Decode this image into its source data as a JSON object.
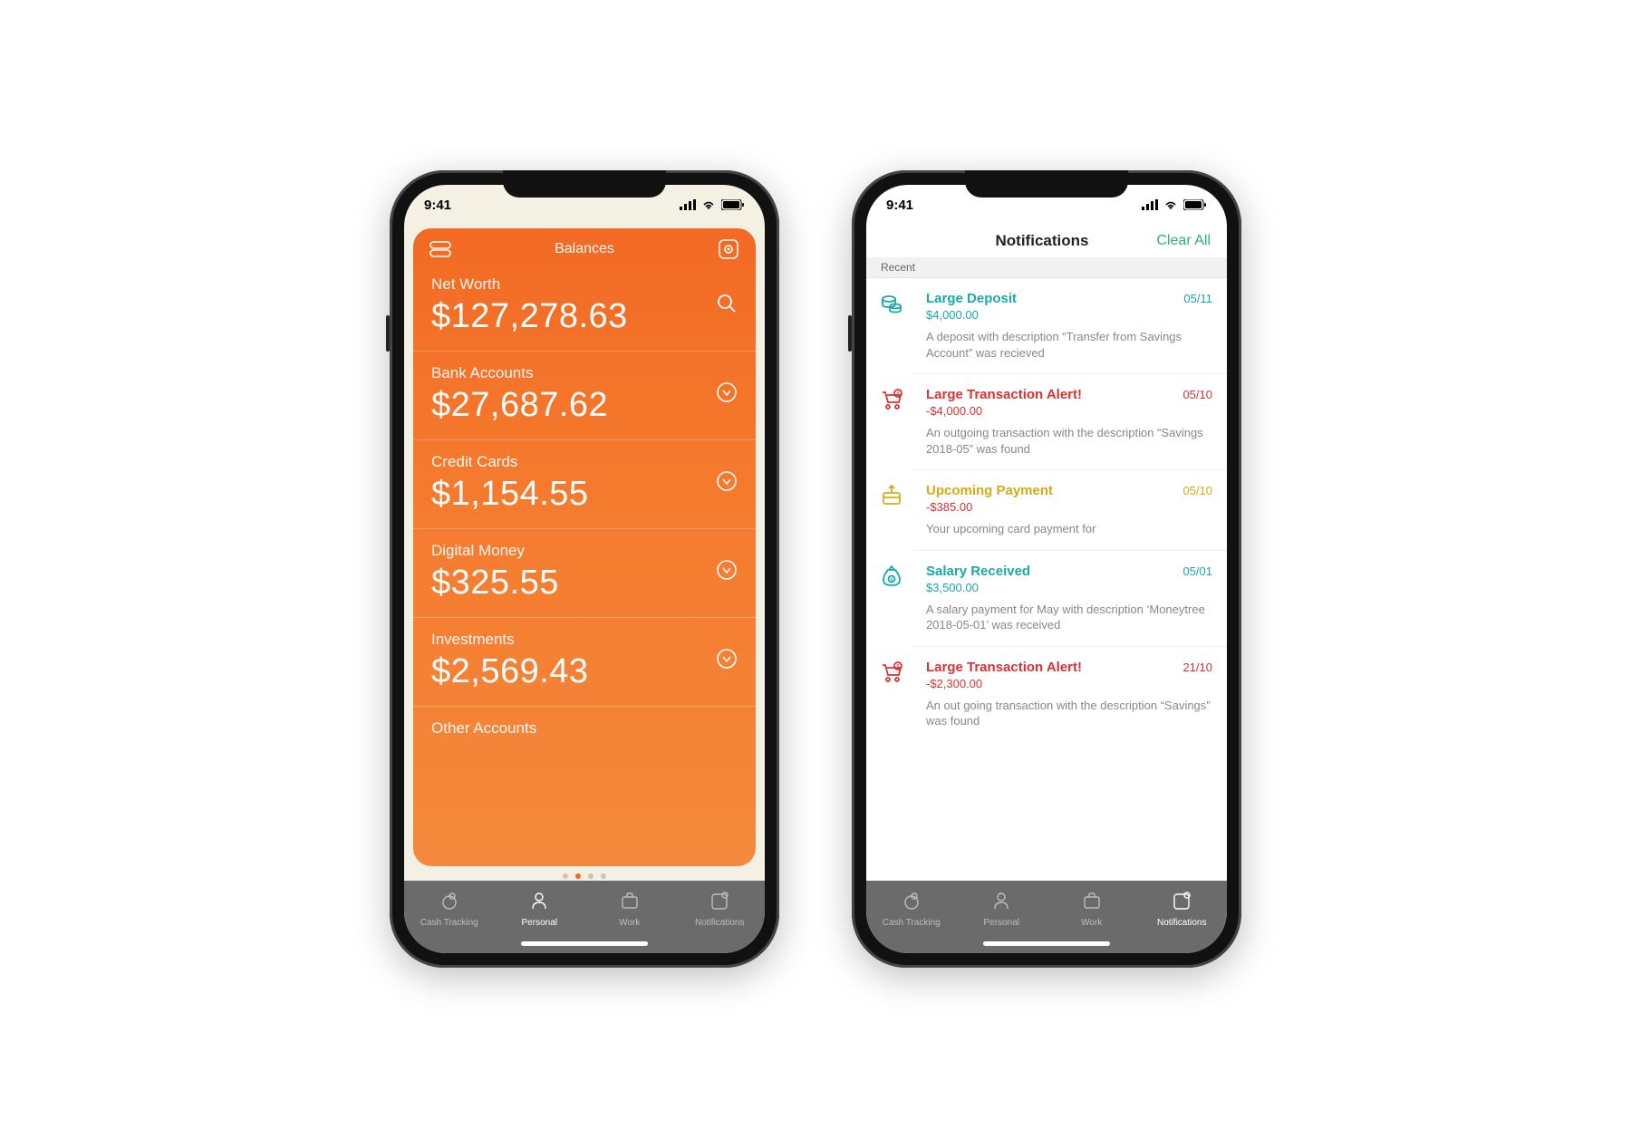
{
  "status": {
    "time": "9:41"
  },
  "balances": {
    "header_title": "Balances",
    "rows": [
      {
        "label": "Net Worth",
        "amount": "$127,278.63",
        "action_icon": "search"
      },
      {
        "label": "Bank Accounts",
        "amount": "$27,687.62",
        "action_icon": "chevron"
      },
      {
        "label": "Credit Cards",
        "amount": "$1,154.55",
        "action_icon": "chevron"
      },
      {
        "label": "Digital Money",
        "amount": "$325.55",
        "action_icon": "chevron"
      },
      {
        "label": "Investments",
        "amount": "$2,569.43",
        "action_icon": "chevron"
      },
      {
        "label": "Other Accounts",
        "amount": "",
        "action_icon": ""
      }
    ]
  },
  "tabs": {
    "items": [
      {
        "label": "Cash Tracking"
      },
      {
        "label": "Personal"
      },
      {
        "label": "Work"
      },
      {
        "label": "Notifications"
      }
    ]
  },
  "notifications": {
    "header_title": "Notifications",
    "clear_label": "Clear All",
    "section_label": "Recent",
    "items": [
      {
        "title": "Large Deposit",
        "amount": "$4,000.00",
        "date": "05/11",
        "desc": "A deposit with description “Transfer from Savings Account” was recieved",
        "color": "teal",
        "icon": "coins"
      },
      {
        "title": "Large Transaction Alert!",
        "amount": "-$4,000.00",
        "date": "05/10",
        "desc": "An outgoing transaction with the description “Savings 2018-05” was found",
        "color": "red",
        "icon": "cart"
      },
      {
        "title": "Upcoming Payment",
        "amount": "-$385.00",
        "date": "05/10",
        "desc": "Your upcoming card payment for",
        "color": "yellow",
        "icon": "upload"
      },
      {
        "title": "Salary Received",
        "amount": "$3,500.00",
        "date": "05/01",
        "desc": "A salary payment for May with description ‘Moneytree 2018-05-01’ was received",
        "color": "teal",
        "icon": "bag"
      },
      {
        "title": "Large Transaction Alert!",
        "amount": "-$2,300.00",
        "date": "21/10",
        "desc": "An out going transaction with the description “Savings” was found",
        "color": "red",
        "icon": "cart"
      }
    ]
  }
}
